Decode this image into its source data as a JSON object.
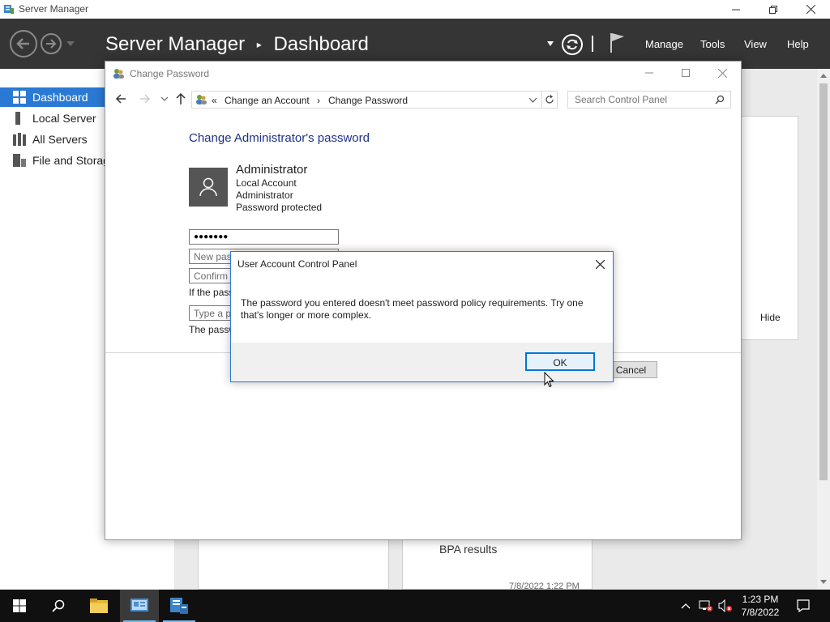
{
  "server_manager": {
    "window_title": "Server Manager",
    "breadcrumb": {
      "root": "Server Manager",
      "separator": "▸",
      "page": "Dashboard"
    },
    "menu": {
      "manage": "Manage",
      "tools": "Tools",
      "view": "View",
      "help": "Help"
    },
    "sidebar": [
      {
        "label": "Dashboard",
        "icon": "dashboard-icon",
        "active": true
      },
      {
        "label": "Local Server",
        "icon": "server-icon"
      },
      {
        "label": "All Servers",
        "icon": "servers-icon"
      },
      {
        "label": "File and Storag",
        "icon": "storage-icon"
      }
    ],
    "hide_label": "Hide",
    "bpa_label": "BPA results",
    "bpa_timestamp": "7/8/2022 1:22 PM"
  },
  "change_password": {
    "window_title": "Change Password",
    "address": {
      "prefix": "«",
      "crumb1": "Change an Account",
      "separator": "›",
      "crumb2": "Change Password"
    },
    "search_placeholder": "Search Control Panel",
    "heading": "Change Administrator's password",
    "user": {
      "name": "Administrator",
      "type": "Local Account",
      "group": "Administrator",
      "status": "Password protected"
    },
    "current_password_value": "●●●●●●●",
    "new_password_placeholder": "New pas",
    "confirm_placeholder": "Confirm",
    "hint_text": "If the pass",
    "hint_placeholder": "Type a p",
    "footer_text": "The passw",
    "cancel_label": "Cancel"
  },
  "uac_dialog": {
    "title": "User Account Control Panel",
    "message": "The password you entered doesn't meet password policy requirements. Try one that's longer or more complex.",
    "ok_label": "OK"
  },
  "taskbar": {
    "time": "1:23 PM",
    "date": "7/8/2022"
  },
  "colors": {
    "header_bg": "#353535",
    "sidebar_active": "#2a7ad5",
    "heading_blue": "#1e3287",
    "ok_border": "#0078d7",
    "taskbar_bg": "#101010"
  }
}
